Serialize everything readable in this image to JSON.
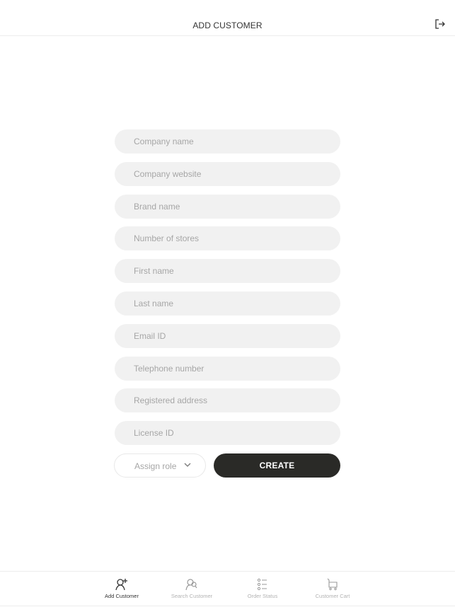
{
  "header": {
    "title": "ADD CUSTOMER",
    "logout_icon": "logout-icon"
  },
  "form": {
    "fields": [
      {
        "placeholder": "Company name",
        "value": ""
      },
      {
        "placeholder": "Company website",
        "value": ""
      },
      {
        "placeholder": "Brand name",
        "value": ""
      },
      {
        "placeholder": "Number of stores",
        "value": ""
      },
      {
        "placeholder": "First name",
        "value": ""
      },
      {
        "placeholder": "Last name",
        "value": ""
      },
      {
        "placeholder": "Email ID",
        "value": ""
      },
      {
        "placeholder": "Telephone number",
        "value": ""
      },
      {
        "placeholder": "Registered address",
        "value": ""
      },
      {
        "placeholder": "License ID",
        "value": ""
      }
    ],
    "role_select": {
      "placeholder": "Assign role",
      "icon": "chevron-down-icon"
    },
    "create_label": "CREATE"
  },
  "colors": {
    "field_bg": "#f1f1f1",
    "placeholder": "#a6a6a6",
    "primary_button": "#2a2a27",
    "active_tab": "#333333",
    "inactive_tab": "#b3b3b3"
  },
  "tabbar": {
    "tabs": [
      {
        "label": "Add Customer",
        "icon": "add-user-icon",
        "active": true
      },
      {
        "label": "Search Customer",
        "icon": "search-user-icon",
        "active": false
      },
      {
        "label": "Order Status",
        "icon": "list-icon",
        "active": false
      },
      {
        "label": "Customer Cart",
        "icon": "cart-icon",
        "active": false
      }
    ]
  }
}
